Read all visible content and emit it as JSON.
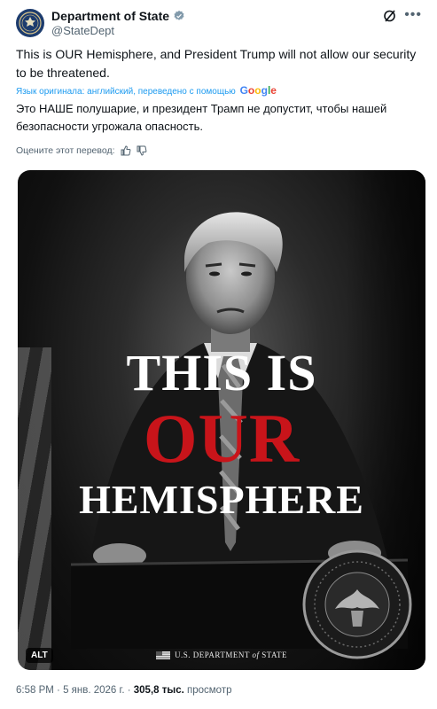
{
  "post": {
    "author_name": "Department of State",
    "author_handle": "@StateDept",
    "text": "This is OUR Hemisphere, and President Trump will not allow our security to be threatened.",
    "translated_by_prefix": "Язык оригинала: английский, переведено с помощью",
    "translator_brand": [
      "G",
      "o",
      "o",
      "g",
      "l",
      "e"
    ],
    "translation": "Это НАШЕ полушарие, и президент Трамп не допустит, чтобы нашей безопасности угрожала опасность.",
    "rate_translation": "Оцените этот перевод:",
    "icons": {
      "avatar": "state-department-seal-icon",
      "verified": "verified-badge-icon",
      "grok": "grok-icon",
      "more": "more-icon",
      "thumb_up": "thumbs-up-icon",
      "thumb_down": "thumbs-down-icon"
    },
    "colors": {
      "link_blue": "#1d9bf0",
      "headline_red": "#c8141a",
      "muted": "#536471"
    }
  },
  "media": {
    "headline_line1": "THIS IS",
    "headline_line2": "OUR",
    "headline_line3": "HEMISPHERE",
    "footer_prefix": "U.S. DEPARTMENT",
    "footer_of": "of",
    "footer_suffix": "STATE",
    "alt_badge": "ALT"
  },
  "meta": {
    "time": "6:58 PM",
    "separator": "·",
    "date": "5 янв. 2026 г.",
    "views_count": "305,8 тыс.",
    "views_label": "просмотр"
  }
}
